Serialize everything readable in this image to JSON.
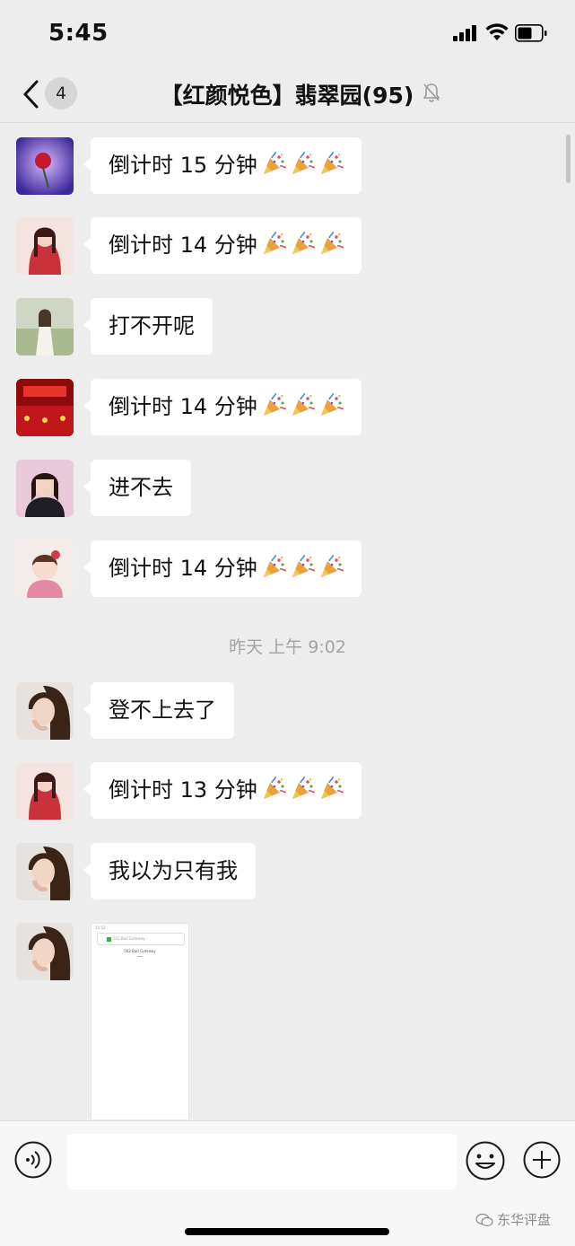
{
  "status_bar": {
    "time": "5:45"
  },
  "nav": {
    "back_count": "4",
    "title": "【红颜悦色】翡翠园(95)"
  },
  "messages": [
    {
      "type": "text",
      "text": "倒计时 15 分钟",
      "emoji_count": 3,
      "avatar": "avatar-rose"
    },
    {
      "type": "text",
      "text": "倒计时 14 分钟",
      "emoji_count": 3,
      "avatar": "avatar-red-girl"
    },
    {
      "type": "text",
      "text": "打不开呢",
      "emoji_count": 0,
      "avatar": "avatar-white-dress"
    },
    {
      "type": "text",
      "text": "倒计时 14 分钟",
      "emoji_count": 3,
      "avatar": "avatar-red-stage"
    },
    {
      "type": "text",
      "text": "进不去",
      "emoji_count": 0,
      "avatar": "avatar-woman-portrait"
    },
    {
      "type": "text",
      "text": "倒计时 14 分钟",
      "emoji_count": 3,
      "avatar": "avatar-child"
    },
    {
      "type": "timestamp",
      "text": "昨天 上午 9:02"
    },
    {
      "type": "text",
      "text": "登不上去了",
      "emoji_count": 0,
      "avatar": "avatar-woman-hand"
    },
    {
      "type": "text",
      "text": "倒计时 13 分钟",
      "emoji_count": 3,
      "avatar": "avatar-red-girl"
    },
    {
      "type": "text",
      "text": "我以为只有我",
      "emoji_count": 0,
      "avatar": "avatar-woman-hand"
    },
    {
      "type": "image",
      "avatar": "avatar-woman-hand",
      "thumbnail": {
        "status_time": "15:52",
        "search_text": "502 Bad Gateway",
        "heading": "502 Bad Gateway"
      }
    }
  ],
  "emoji_name": "party-popper",
  "input": {
    "value": "",
    "placeholder": ""
  },
  "watermark": "东华评盘",
  "colors": {
    "background": "#ededed",
    "bubble": "#ffffff",
    "timestamp": "#a3a3a3"
  }
}
